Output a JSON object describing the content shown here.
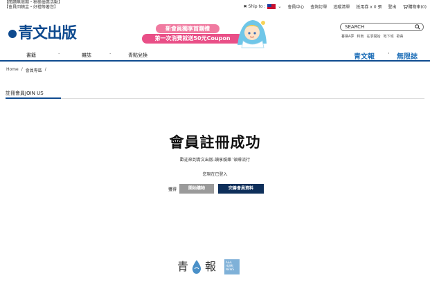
{
  "topbar": {
    "promo_line1": "【閱讀無限期・積極優惠活動】",
    "promo_line2": "【會員回饋金・好禮等著您】",
    "ship_to_label": "Ship to :",
    "links": [
      "會員中心",
      "查詢訂單",
      "追蹤清單",
      "抵用券 x 0 張",
      "登出"
    ],
    "cart_label": "購物車(0)"
  },
  "header": {
    "logo_text": "青文出版",
    "banner_line1": "新會員獨享首購禮",
    "banner_line2": "第一次消費就送50元Coupon",
    "search_placeholder": "SEARCH",
    "search_tags": [
      "暮橫A夢",
      "和南",
      "在季開始",
      "地下城",
      "歌曲"
    ]
  },
  "nav": {
    "items": [
      "書籍",
      "雜誌",
      "青點兌換"
    ],
    "right_items": [
      "青文報",
      "無限誌"
    ]
  },
  "breadcrumb": [
    "Home",
    "/",
    "會員專區",
    "/"
  ],
  "tab": {
    "label": "註冊會員JOIN US"
  },
  "main": {
    "title": "會員註冊成功",
    "welcome": "歡迎來到青文出版-讀享娛樂˙領導流行",
    "logged_in": "您現在已登入",
    "action_prefix": "獲得",
    "start_shopping": "開始購物",
    "complete_profile": "完善會員資料"
  },
  "footer": {
    "logo_left": "青",
    "logo_right": "報",
    "badge_lines": [
      "A&A",
      "HUMI",
      "NEWS"
    ]
  },
  "colors": {
    "brand_blue": "#0e4a8f",
    "accent_blue": "#1f6fb8",
    "banner_pink": "#e94f87",
    "button_dark": "#0e2f5a",
    "button_gray": "#9a9a9a"
  }
}
